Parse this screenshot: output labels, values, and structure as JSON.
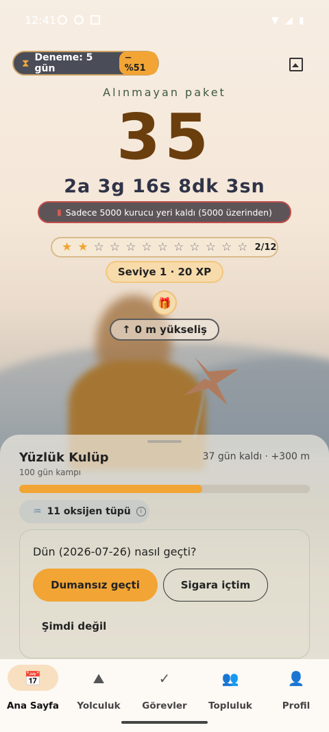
{
  "status_bar": {
    "time": "12:41"
  },
  "trial": {
    "label": "Deneme: 5 gün",
    "discount": "−%51",
    "icon": "hourglass-icon"
  },
  "header": {
    "subtitle": "Alınmayan paket",
    "count": "35",
    "countdown": "2a 3g 16s 8dk 3sn"
  },
  "founder": {
    "text": "Sadece 5000 kurucu yeri kaldı (5000 üzerinden)",
    "icon": "battery-icon"
  },
  "stars": {
    "filled": 2,
    "total": 12,
    "label": "2/12"
  },
  "level": {
    "label": "Seviye 1 · 20 XP"
  },
  "elevation": {
    "arrow": "↑",
    "label": "0 m yükseliş"
  },
  "club": {
    "title": "Yüzlük Kulüp",
    "subtitle": "100 gün kampı",
    "status": "37 gün kaldı · +300 m",
    "progress": 0.63
  },
  "oxygen": {
    "label": "11 oksijen tüpü",
    "info": "i"
  },
  "checkin": {
    "question": "Dün (2026-07-26) nasıl geçti?",
    "primary": "Dumansız geçti",
    "secondary": "Sigara içtim",
    "tertiary": "Şimdi değil"
  },
  "nav": {
    "items": [
      {
        "label": "Ana Sayfa",
        "icon": "calendar-icon",
        "glyph": "📅"
      },
      {
        "label": "Yolculuk",
        "icon": "mountain-icon",
        "glyph": "⛰"
      },
      {
        "label": "Görevler",
        "icon": "check-circle-icon",
        "glyph": "✓"
      },
      {
        "label": "Topluluk",
        "icon": "group-icon",
        "glyph": "👥"
      },
      {
        "label": "Profil",
        "icon": "person-icon",
        "glyph": "👤"
      }
    ]
  },
  "colors": {
    "accent": "#f2a534",
    "brown": "#6b3e0e",
    "dark": "#2f3347"
  }
}
